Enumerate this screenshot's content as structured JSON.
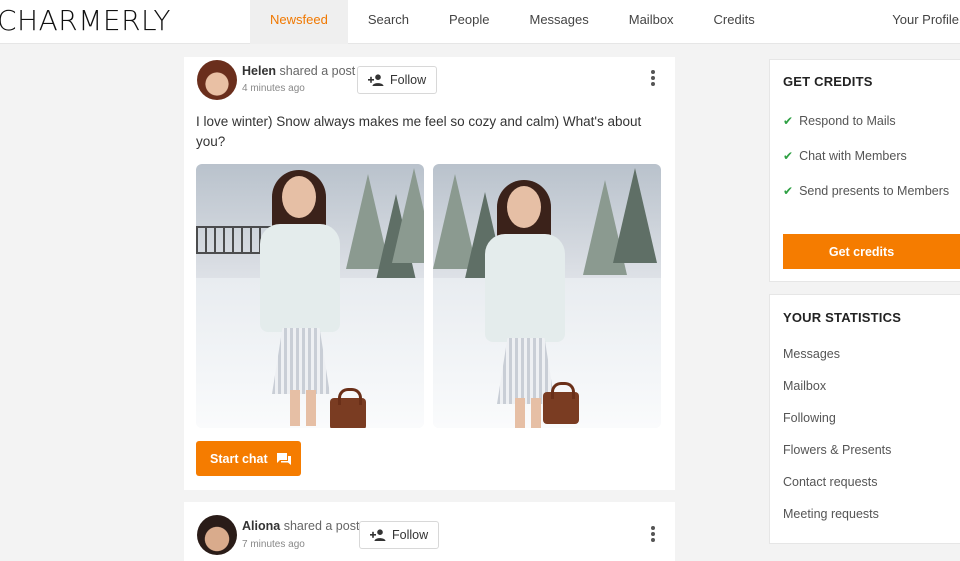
{
  "brand": {
    "logo": "CHARMERLY"
  },
  "nav": {
    "items": [
      {
        "label": "Newsfeed",
        "active": true
      },
      {
        "label": "Search"
      },
      {
        "label": "People"
      },
      {
        "label": "Messages"
      },
      {
        "label": "Mailbox"
      },
      {
        "label": "Credits"
      }
    ],
    "profile": "Your Profile"
  },
  "colors": {
    "accent": "#f57c00",
    "check": "#2ea043"
  },
  "posts": [
    {
      "author": "Helen",
      "action": "shared a post",
      "time": "4 minutes ago",
      "follow_label": "Follow",
      "text": "I love winter) Snow always makes me feel so cozy and calm) What's about you?",
      "start_chat_label": "Start chat"
    },
    {
      "author": "Aliona",
      "action": "shared a post",
      "time": "7 minutes ago",
      "follow_label": "Follow"
    }
  ],
  "sidebar": {
    "credits": {
      "title": "GET CREDITS",
      "items": [
        "Respond to Mails",
        "Chat with Members",
        "Send presents to Members"
      ],
      "button": "Get credits"
    },
    "stats": {
      "title": "YOUR STATISTICS",
      "items": [
        "Messages",
        "Mailbox",
        "Following",
        "Flowers & Presents",
        "Contact requests",
        "Meeting requests"
      ]
    }
  }
}
